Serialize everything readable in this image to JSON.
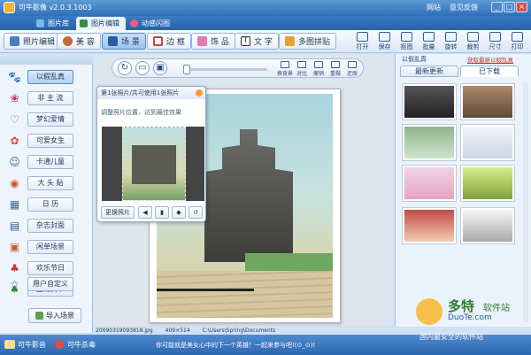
{
  "window": {
    "title": "可牛影像 v2.0.3.1003",
    "links": [
      "网站",
      "意见反馈"
    ],
    "controls": [
      "_",
      "□",
      "×"
    ]
  },
  "tabs": [
    {
      "label": "图片库"
    },
    {
      "label": "图片编辑"
    },
    {
      "label": "动感闪图"
    }
  ],
  "toolbar": {
    "left": [
      {
        "label": "照片编辑"
      },
      {
        "label": "美 容"
      },
      {
        "label": "场 景"
      },
      {
        "label": "边 框"
      },
      {
        "label": "饰 品"
      },
      {
        "label": "文 字"
      },
      {
        "label": "多图拼贴"
      }
    ],
    "right": [
      {
        "label": "打开"
      },
      {
        "label": "保存"
      },
      {
        "label": "抠图"
      },
      {
        "label": "批量"
      },
      {
        "label": "旋转"
      },
      {
        "label": "裁剪"
      },
      {
        "label": "尺寸"
      },
      {
        "label": "打印"
      }
    ]
  },
  "categories": [
    {
      "label": "以假乱真",
      "icon": "🐾"
    },
    {
      "label": "非 主 流",
      "icon": "❀"
    },
    {
      "label": "梦幻爱情",
      "icon": "♡"
    },
    {
      "label": "可爱女生",
      "icon": "✿"
    },
    {
      "label": "卡通儿童",
      "icon": "☺"
    },
    {
      "label": "大 头 贴",
      "icon": "◉"
    },
    {
      "label": "日  历",
      "icon": "▦"
    },
    {
      "label": "杂志封面",
      "icon": "▤"
    },
    {
      "label": "闲单场景",
      "icon": "▣"
    },
    {
      "label": "欢乐节日",
      "icon": "♣"
    },
    {
      "label": "圣诞贺卡",
      "icon": "♠"
    },
    {
      "label": "用户自定义",
      "icon": "☆"
    }
  ],
  "import_label": "导入场景",
  "canvas_tools": [
    {
      "label": "换背景"
    },
    {
      "label": "对比"
    },
    {
      "label": "撤销"
    },
    {
      "label": "重做"
    },
    {
      "label": "还原"
    }
  ],
  "dialog": {
    "title": "第1张照片/共可使用1张照片",
    "hint": "调整照片位置，达到最佳效果",
    "replace_label": "更换照片"
  },
  "right_panel": {
    "title": "以假乱真",
    "link": "获取最新以假乱真",
    "tabs": [
      {
        "label": "最新更新"
      },
      {
        "label": "已下载"
      }
    ]
  },
  "path_bar": {
    "file": "20090319093818.jpg",
    "size": "409×514",
    "path": "C:\\Users\\Spring\\Documents"
  },
  "statusbar": {
    "left1": "可牛影音",
    "left2": "可牛杀毒",
    "message": "你可能就是美女心中的下一个英雄！一起来参与吧!(⊙_⊙)!"
  },
  "watermark": {
    "line1": "多特",
    "line2": "软件站",
    "url": "DuoTe.com",
    "line3": "国内最安全的软件站"
  },
  "colors": {
    "title_bar": "#2f6fb8",
    "accent": "#4d86c7",
    "link": "#c03228"
  }
}
